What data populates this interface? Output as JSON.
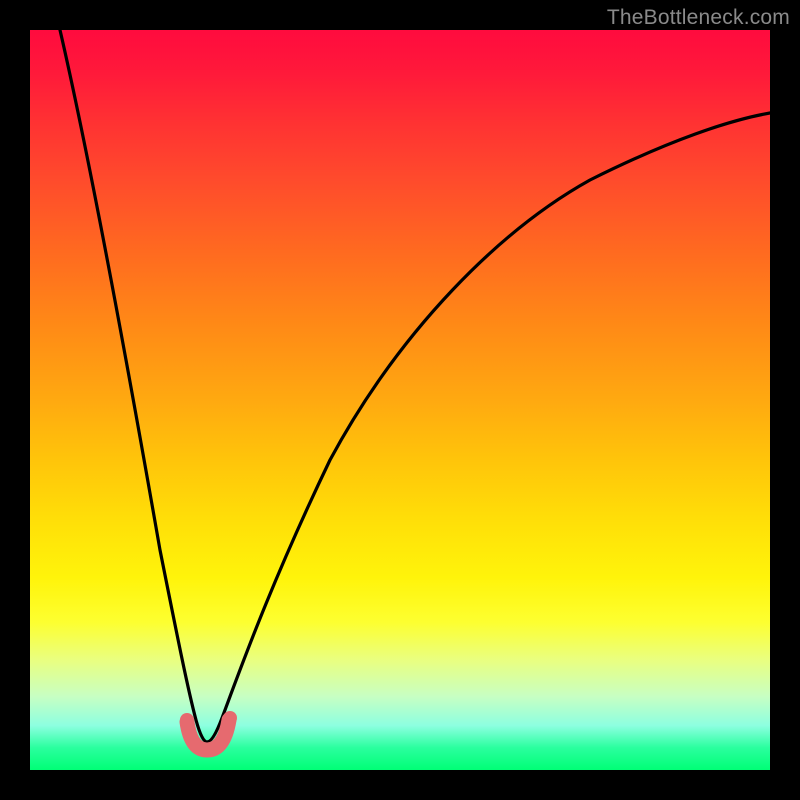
{
  "watermark": "TheBottleneck.com",
  "chart_data": {
    "type": "line",
    "title": "",
    "xlabel": "",
    "ylabel": "",
    "xlim": [
      0,
      100
    ],
    "ylim": [
      0,
      100
    ],
    "grid": false,
    "legend": false,
    "gradient_stops": [
      {
        "pos": 0,
        "color": "#ff0b3e"
      },
      {
        "pos": 25,
        "color": "#ff5a24"
      },
      {
        "pos": 50,
        "color": "#ffa910"
      },
      {
        "pos": 75,
        "color": "#fff40a"
      },
      {
        "pos": 90,
        "color": "#c8ffc2"
      },
      {
        "pos": 100,
        "color": "#00ff76"
      }
    ],
    "minimum_x": 23,
    "series": [
      {
        "name": "bottleneck-curve",
        "x": [
          4,
          6,
          8,
          10,
          12,
          14,
          16,
          18,
          20,
          21,
          22,
          23,
          24,
          25,
          26,
          28,
          30,
          34,
          40,
          50,
          60,
          70,
          80,
          90,
          100
        ],
        "y": [
          100,
          90,
          80,
          70,
          60,
          49,
          38,
          26,
          12,
          6,
          2,
          0,
          2,
          6,
          11,
          20,
          28,
          40,
          53,
          66,
          74,
          79,
          83,
          86,
          88
        ]
      },
      {
        "name": "marker-band",
        "x": [
          20,
          21,
          22,
          23,
          24,
          25,
          26
        ],
        "y": [
          6,
          3,
          1,
          0,
          1,
          3,
          6
        ]
      }
    ],
    "annotations": []
  }
}
